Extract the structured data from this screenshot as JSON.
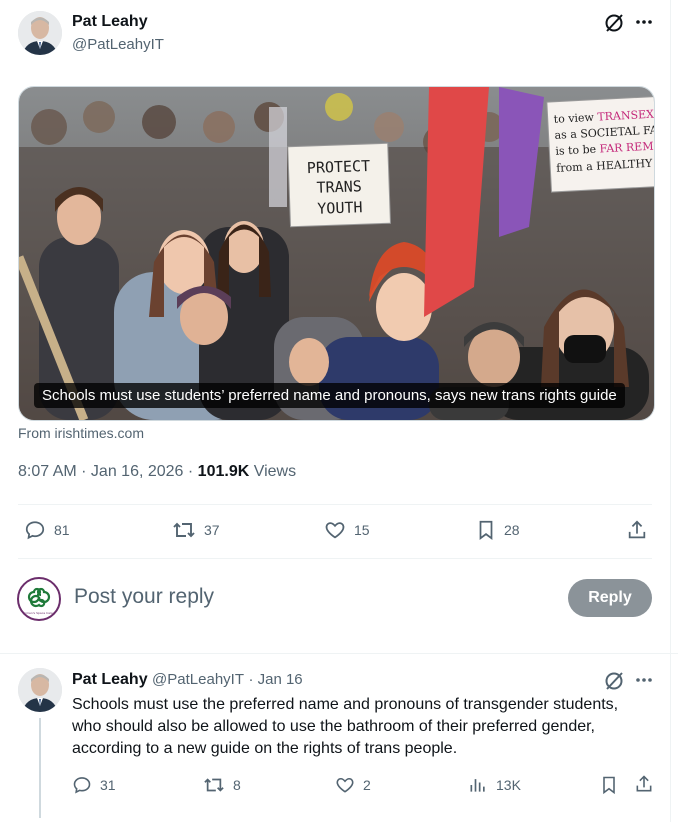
{
  "main_tweet": {
    "author_name": "Pat Leahy",
    "author_handle": "@PatLeahyIT",
    "card": {
      "caption": "Schools must use students’ preferred name and pronouns, says new trans rights guide",
      "sign_left": "PROTECT TRANS YOUTH",
      "sign_right": "to view TRANSEXUALITY as a SOCIETAL FAILING is to be FAR REMOVED from a HEALTHY SOCIETY",
      "source": "From irishtimes.com"
    },
    "time": "8:07 AM · Jan 16, 2026 · ",
    "views_count": "101.9K",
    "views_label": " Views",
    "stats": {
      "replies": "81",
      "reposts": "37",
      "likes": "15",
      "bookmarks": "28"
    }
  },
  "reply_box": {
    "placeholder": "Post your reply",
    "button": "Reply",
    "avatar_text": "Women's Space Ireland"
  },
  "reply_tweet": {
    "author_name": "Pat Leahy",
    "author_handle": "@PatLeahyIT",
    "date": "· Jan 16",
    "text": "Schools must use the preferred name and pronouns of transgender students, who should also be allowed to use the bathroom of their preferred gender, according to a new guide on the rights of trans people.",
    "stats": {
      "replies": "31",
      "reposts": "8",
      "likes": "2",
      "views": "13K"
    }
  },
  "colors": {
    "accent_green": "#1f7a3a",
    "accent_purple": "#6b2d6b",
    "muted": "#536471"
  }
}
